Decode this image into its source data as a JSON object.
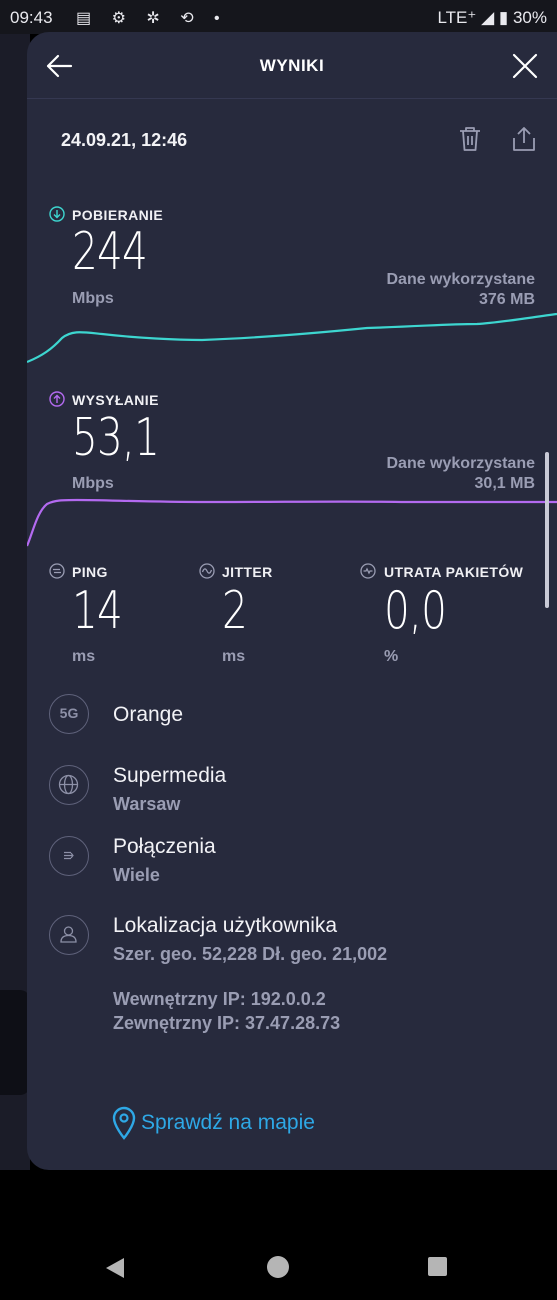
{
  "status_bar": {
    "time": "09:43",
    "network": "LTE⁺",
    "battery": "30%"
  },
  "header": {
    "title": "WYNIKI"
  },
  "result": {
    "datetime": "24.09.21, 12:46"
  },
  "download": {
    "label": "POBIERANIE",
    "value": "244",
    "unit": "Mbps",
    "data_used_label": "Dane wykorzystane",
    "data_used": "376 MB",
    "color": "#3dd6d0"
  },
  "upload": {
    "label": "WYSYŁANIE",
    "value": "53,1",
    "unit": "Mbps",
    "data_used_label": "Dane wykorzystane",
    "data_used": "30,1 MB",
    "color": "#b36af0"
  },
  "ping": {
    "label": "PING",
    "value": "14",
    "unit": "ms"
  },
  "jitter": {
    "label": "JITTER",
    "value": "2",
    "unit": "ms"
  },
  "packet_loss": {
    "label": "UTRATA PAKIETÓW",
    "value": "0,0",
    "unit": "%"
  },
  "info": {
    "provider": {
      "icon_text": "5G",
      "title": "Orange"
    },
    "server": {
      "title": "Supermedia",
      "subtitle": "Warsaw"
    },
    "connections": {
      "title": "Połączenia",
      "subtitle": "Wiele"
    },
    "location": {
      "title": "Lokalizacja użytkownika",
      "subtitle": "Szer. geo. 52,228 Dł. geo. 21,002",
      "internal_ip": "Wewnętrzny IP: 192.0.0.2",
      "external_ip": "Zewnętrzny IP: 37.47.28.73"
    }
  },
  "map_link": {
    "label": "Sprawdź na mapie",
    "color": "#2ea8e6"
  },
  "icons": {
    "back": "arrow-left-icon",
    "close": "close-icon",
    "trash": "trash-icon",
    "share": "share-icon",
    "download": "arrow-down-circle-icon",
    "upload": "arrow-up-circle-icon",
    "globe": "globe-icon",
    "connections": "connections-icon",
    "user": "user-icon",
    "pin": "map-pin-icon"
  }
}
